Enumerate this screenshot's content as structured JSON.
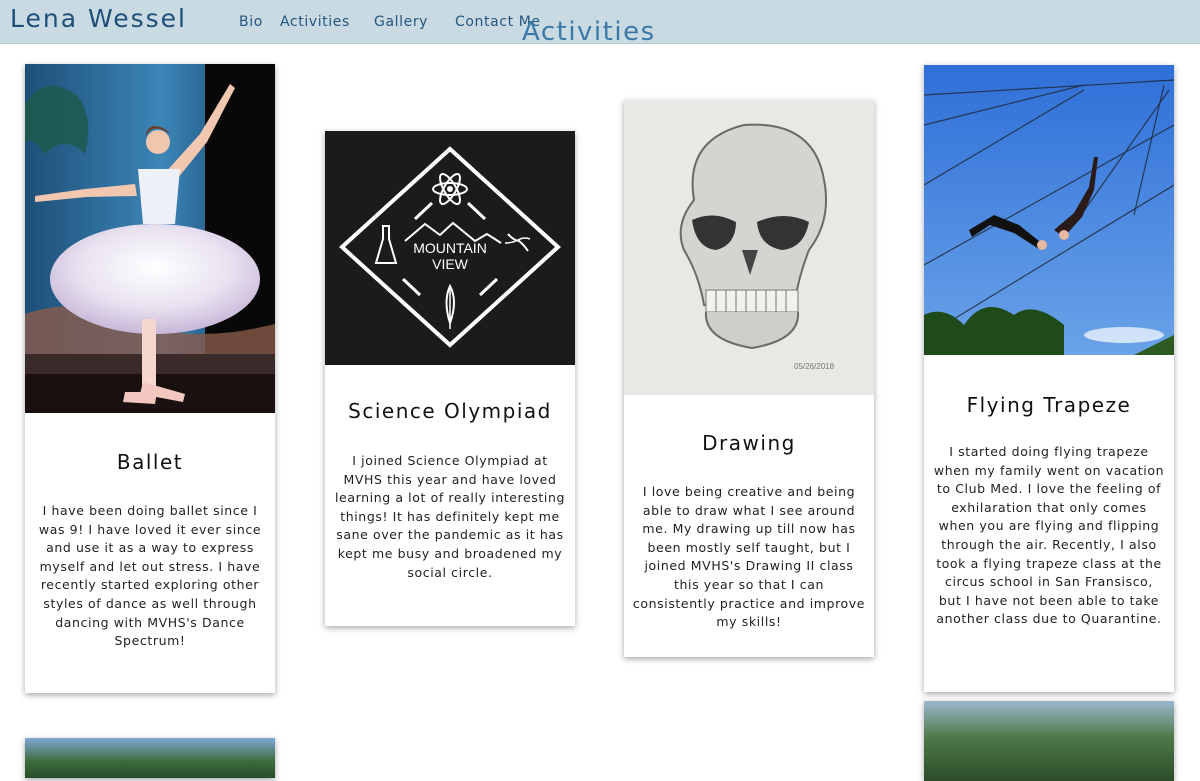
{
  "nav": {
    "brand": "Lena Wessel",
    "links": [
      "Bio",
      "Activities",
      "Gallery",
      "Contact Me"
    ]
  },
  "section_title": "Activities",
  "cards": [
    {
      "title": "Ballet",
      "text": "I have been doing ballet since I was 9! I have loved it ever since and use it as a way to express myself and let out stress. I have recently started exploring other styles of dance as well through dancing with MVHS's Dance Spectrum!",
      "image_icon": "ballerina-photo"
    },
    {
      "title": "Science Olympiad",
      "text": "I joined Science Olympiad at MVHS this year and have loved learning a lot of really interesting things! It has definitely kept me sane over the pandemic as it has kept me busy and broadened my social circle.",
      "image_icon": "science-olympiad-logo",
      "logo_text_1": "MOUNTAIN",
      "logo_text_2": "VIEW"
    },
    {
      "title": "Drawing",
      "text": "I love being creative and being able to draw what I see around me. My drawing up till now has been mostly self taught, but I joined MVHS's Drawing II class this year so that I can consistently practice and improve my skills!",
      "image_icon": "skull-drawing",
      "drawing_date": "05/26/2018"
    },
    {
      "title": "Flying Trapeze",
      "text": "I started doing flying trapeze when my family went on vacation to Club Med. I love the feeling of exhilaration that only comes when you are flying and flipping through the air. Recently, I also took a flying trapeze class at the circus school in San Fransisco, but I have not been able to take another class due to Quarantine.",
      "image_icon": "trapeze-photo"
    }
  ],
  "colors": {
    "navbar": "#c9dae3",
    "brand": "#1e4e7a",
    "nav_link": "#24557f",
    "section_title": "#3b7aa8"
  }
}
